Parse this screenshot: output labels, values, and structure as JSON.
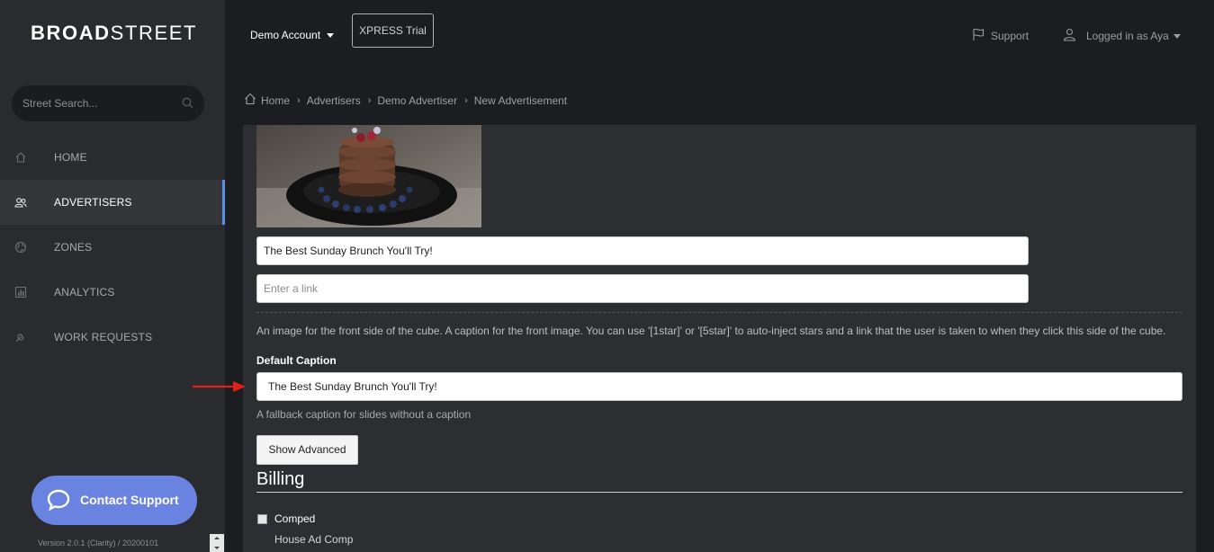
{
  "brand": {
    "part1": "BROAD",
    "part2": "STREET"
  },
  "sidebar": {
    "search_placeholder": "Street Search...",
    "items": [
      {
        "label": "HOME",
        "icon": "home-icon"
      },
      {
        "label": "ADVERTISERS",
        "icon": "users-icon",
        "active": true
      },
      {
        "label": "ZONES",
        "icon": "globe-icon"
      },
      {
        "label": "ANALYTICS",
        "icon": "chart-icon"
      },
      {
        "label": "WORK REQUESTS",
        "icon": "wrench-icon"
      }
    ],
    "contact_label": "Contact Support",
    "version": "Version 2.0.1 (Clarity) / 20200101"
  },
  "topbar": {
    "account": "Demo Account",
    "trial_button": "XPRESS Trial",
    "support": "Support",
    "user": "Logged in as Aya"
  },
  "breadcrumb": [
    "Home",
    "Advertisers",
    "Demo Advertiser",
    "New Advertisement"
  ],
  "form": {
    "front_caption_value": "The Best Sunday Brunch You'll Try!",
    "front_link_placeholder": "Enter a link",
    "help_text": "An image for the front side of the cube. A caption for the front image. You can use '[1star]' or '[5star]' to auto-inject stars and a link that the user is taken to when they click this side of the cube.",
    "default_caption_label": "Default Caption",
    "default_caption_value": "The Best Sunday Brunch You'll Try!",
    "fallback_text": "A fallback caption for slides without a caption",
    "show_advanced": "Show Advanced"
  },
  "billing": {
    "title": "Billing",
    "comped_label": "Comped",
    "comped_checked": false,
    "house_label": "House Ad Comp"
  },
  "colors": {
    "sidebar_bg": "#2a2b2e",
    "page_bg": "#1c1d20",
    "accent": "#5b8de3",
    "contact_button": "#6a82e0",
    "annotation_arrow": "#e0201b"
  }
}
